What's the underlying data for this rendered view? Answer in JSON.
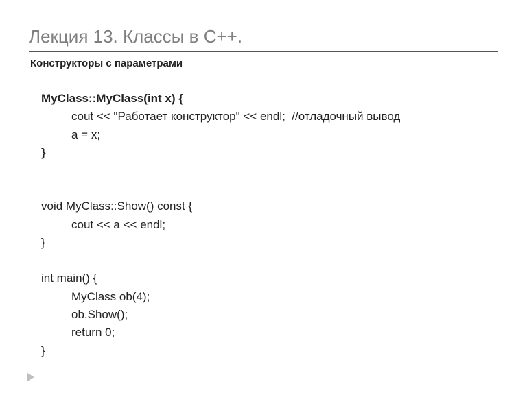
{
  "title": "Лекция 13. Классы в С++.",
  "subtitle": "Конструкторы с параметрами",
  "code": {
    "l1": "MyClass::MyClass(int x) {",
    "l2": "cout << \"Работает конструктор\" << endl;  //отладочный вывод",
    "l3": "a = x;",
    "l4": "}",
    "l5": "void MyClass::Show() const {",
    "l6": "cout << a << endl;",
    "l7": "}",
    "l8": "int main() {",
    "l9": "MyClass ob(4);",
    "l10": "ob.Show();",
    "l11": "return 0;",
    "l12": "}"
  }
}
